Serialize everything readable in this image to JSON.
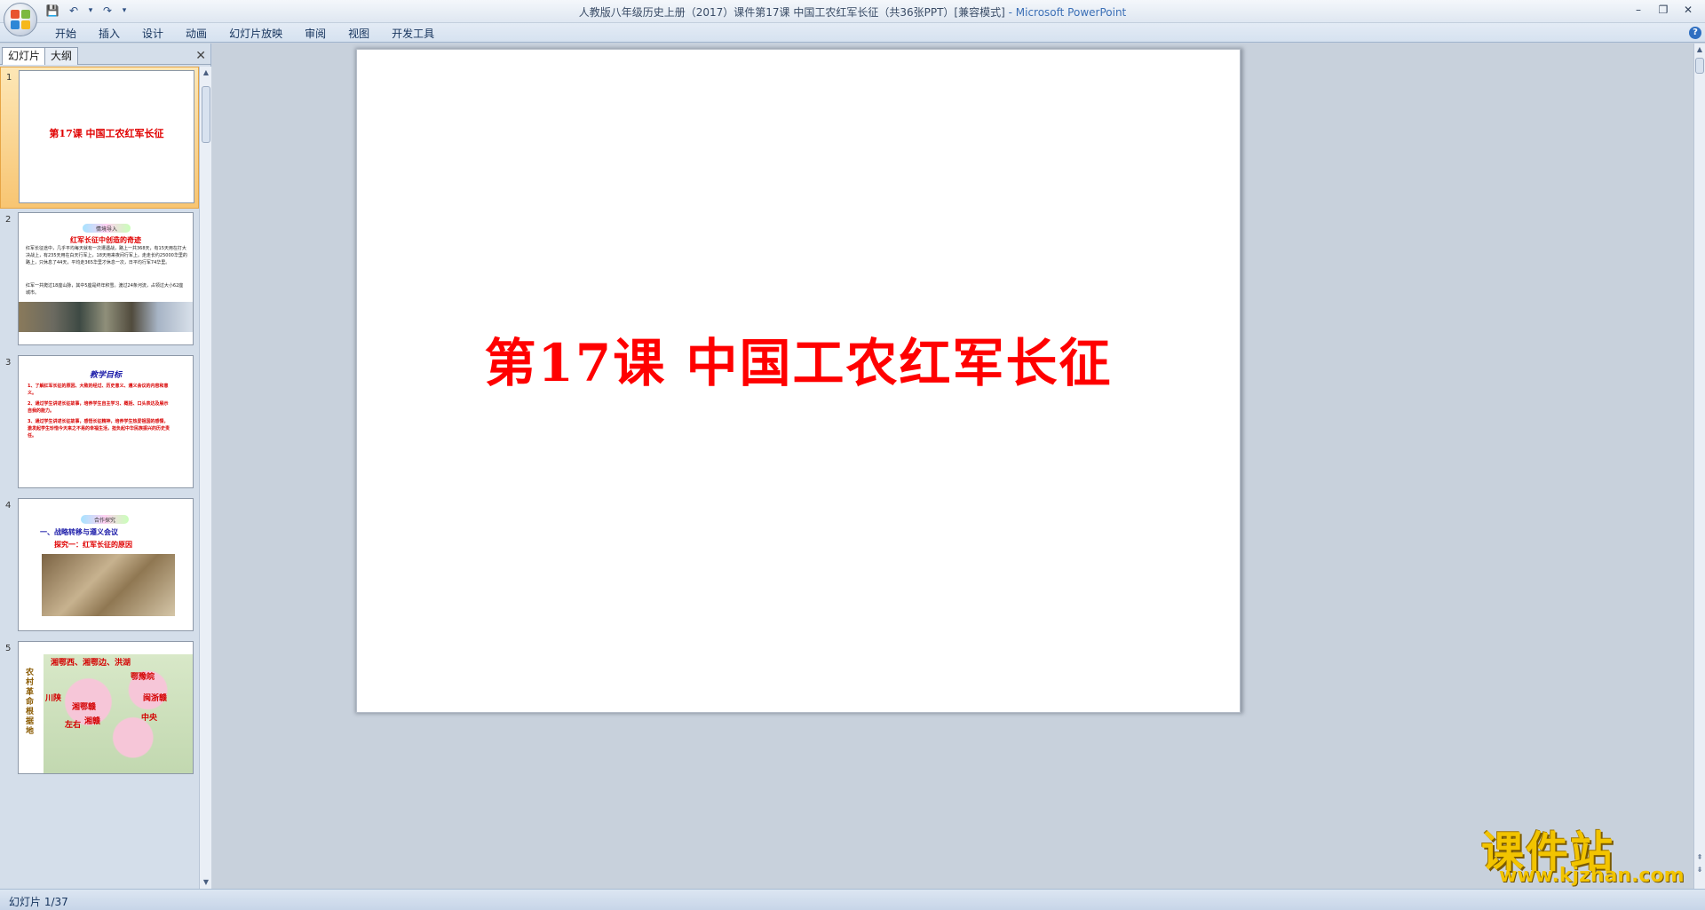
{
  "window": {
    "title": "人教版八年级历史上册（2017）课件第17课 中国工农红军长征（共36张PPT）[兼容模式]",
    "app_name": " - Microsoft PowerPoint",
    "controls": [
      "–",
      "❐",
      "✕"
    ]
  },
  "quick_access": [
    "💾",
    "↶",
    "▾",
    "↷",
    "▾"
  ],
  "ribbon": {
    "tabs": [
      "开始",
      "插入",
      "设计",
      "动画",
      "幻灯片放映",
      "审阅",
      "视图",
      "开发工具"
    ],
    "help": "?"
  },
  "left_pane": {
    "tabs": [
      "幻灯片",
      "大纲"
    ],
    "close": "✕",
    "slides": [
      {
        "num": "1",
        "title": "第17课  中国工农红军长征"
      },
      {
        "num": "2",
        "badge": "情境导入",
        "title": "红军长征中创造的奇迹",
        "body1": "红军长征途中，几乎平均每天就有一次遭遇战，路上一共368天，有15天用在打大决战上，有235天用在白天行军上，18天用来夜间行军上。走走长约25000华里的路上，只休息了44天，平均走365华里才休息一次，日平均行军74华里。",
        "body2": "红军一共爬过18座山脉，其中5座是终年积雪。渡过24条河流，占领过大小62座城市。"
      },
      {
        "num": "3",
        "title": "教学目标",
        "items": [
          "1、了解红军长征的原因、大致的经过、历史意义、遵义会议的内容和意义。",
          "2、通过学生讲述长征故事，培养学生自主学习、概括、口头表达及展示自我的能力。",
          "3、通过学生讲述长征故事，感悟长征精神，培养学生热爱祖国的感情，激发起学生珍惜今天来之不易的幸福生活，担负起中华民族振兴的历史责任。"
        ]
      },
      {
        "num": "4",
        "badge": "合作探究",
        "title": "一、战略转移与遵义会议",
        "subtitle": "探究一：红军长征的原因"
      },
      {
        "num": "5",
        "vertical": "农村革命根据地",
        "labels": [
          "湘鄂西、湘鄂边、洪湖",
          "鄂豫皖",
          "川陕",
          "闽浙赣",
          "湘鄂赣",
          "中央",
          "湘赣",
          "左右"
        ]
      }
    ]
  },
  "slide": {
    "title": "第17课  中国工农红军长征"
  },
  "status": {
    "text": "幻灯片 1/37"
  },
  "watermark": {
    "cn": "课件站",
    "url": "www.kjzhan.com"
  },
  "colors": {
    "slide_title": "#ff0000",
    "thumb_selected": "#f8c572",
    "ribbon": "#d6e2f0"
  }
}
